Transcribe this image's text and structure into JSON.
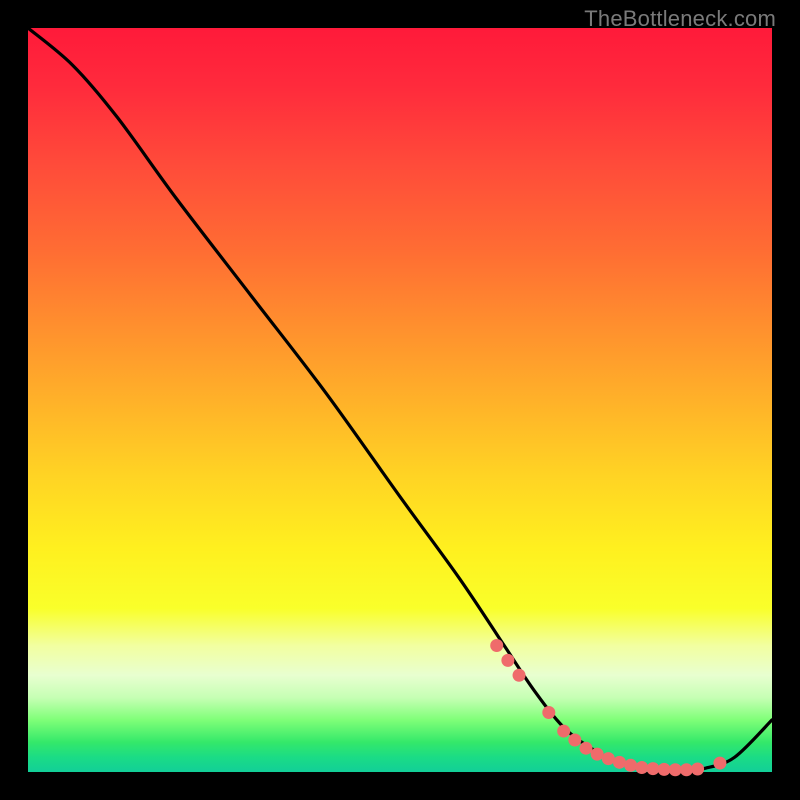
{
  "watermark": "TheBottleneck.com",
  "chart_data": {
    "type": "line",
    "title": "",
    "xlabel": "",
    "ylabel": "",
    "xlim": [
      0,
      100
    ],
    "ylim": [
      0,
      100
    ],
    "series": [
      {
        "name": "bottleneck-curve",
        "x": [
          0,
          6,
          12,
          20,
          30,
          40,
          50,
          58,
          64,
          68,
          72,
          76,
          80,
          84,
          88,
          91,
          95,
          100
        ],
        "values": [
          100,
          95,
          88,
          77,
          64,
          51,
          37,
          26,
          17,
          11,
          6,
          3,
          1,
          0.4,
          0.2,
          0.5,
          2,
          7
        ]
      }
    ],
    "dots": {
      "name": "highlight-dots",
      "x": [
        63,
        64.5,
        66,
        70,
        72,
        73.5,
        75,
        76.5,
        78,
        79.5,
        81,
        82.5,
        84,
        85.5,
        87,
        88.5,
        90,
        93
      ],
      "values": [
        17,
        15,
        13,
        8,
        5.5,
        4.3,
        3.2,
        2.4,
        1.8,
        1.3,
        0.9,
        0.6,
        0.45,
        0.35,
        0.3,
        0.3,
        0.4,
        1.2
      ]
    },
    "colors": {
      "curve": "#000000",
      "dots": "#ef6b6b",
      "gradient_top": "#ff1a3a",
      "gradient_mid": "#fff01f",
      "gradient_bottom": "#12cf98"
    }
  }
}
